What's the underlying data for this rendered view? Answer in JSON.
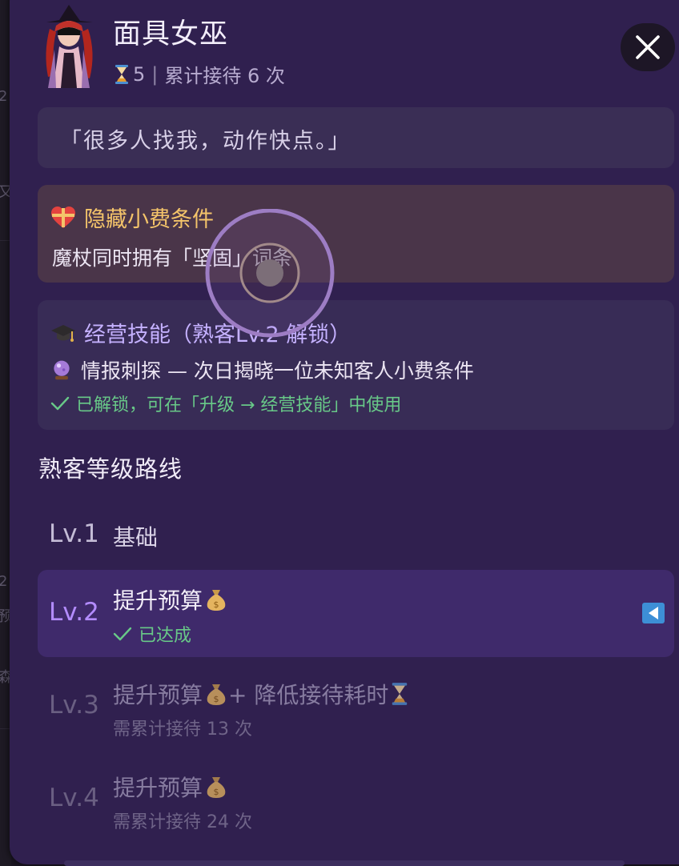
{
  "background_fragments": [
    "2",
    "又",
    "2",
    "预",
    "森"
  ],
  "profile": {
    "name": "面具女巫",
    "wait_value": "5",
    "separator": "|",
    "total_served": "累计接待 6 次"
  },
  "quote": "「很多人找我，动作快点。」",
  "hidden_tip": {
    "title": "隐藏小费条件",
    "condition": "魔杖同时拥有「坚固」词条"
  },
  "business_skill": {
    "title": "经营技能（熟客Lv.2 解锁）",
    "skill": "情报刺探 — 次日揭晓一位未知客人小费条件",
    "status": "已解锁，可在「升级 → 经营技能」中使用"
  },
  "route": {
    "title": "熟客等级路线",
    "levels": [
      {
        "label": "Lv.1",
        "title": "基础",
        "desc": ""
      },
      {
        "label": "Lv.2",
        "title": "提升预算",
        "desc": "已达成",
        "current": true
      },
      {
        "label": "Lv.3",
        "title": "提升预算",
        "title_extra": " + 降低接待耗时",
        "desc": "需累计接待 13 次"
      },
      {
        "label": "Lv.4",
        "title": "提升预算",
        "desc": "需累计接待 24 次"
      }
    ]
  },
  "colors": {
    "panel": "#30204f",
    "accent_purple": "#c5b1ff",
    "tip_gold": "#f4c46a",
    "success_green": "#68c988",
    "current_row": "#3f2a6b",
    "marker_blue": "#3d8fd6"
  },
  "icons": [
    "avatar-witch",
    "hourglass-icon",
    "close-icon",
    "heart-gift-icon",
    "graduation-cap-icon",
    "crystal-ball-icon",
    "check-icon",
    "money-bag-icon",
    "current-marker-icon"
  ]
}
